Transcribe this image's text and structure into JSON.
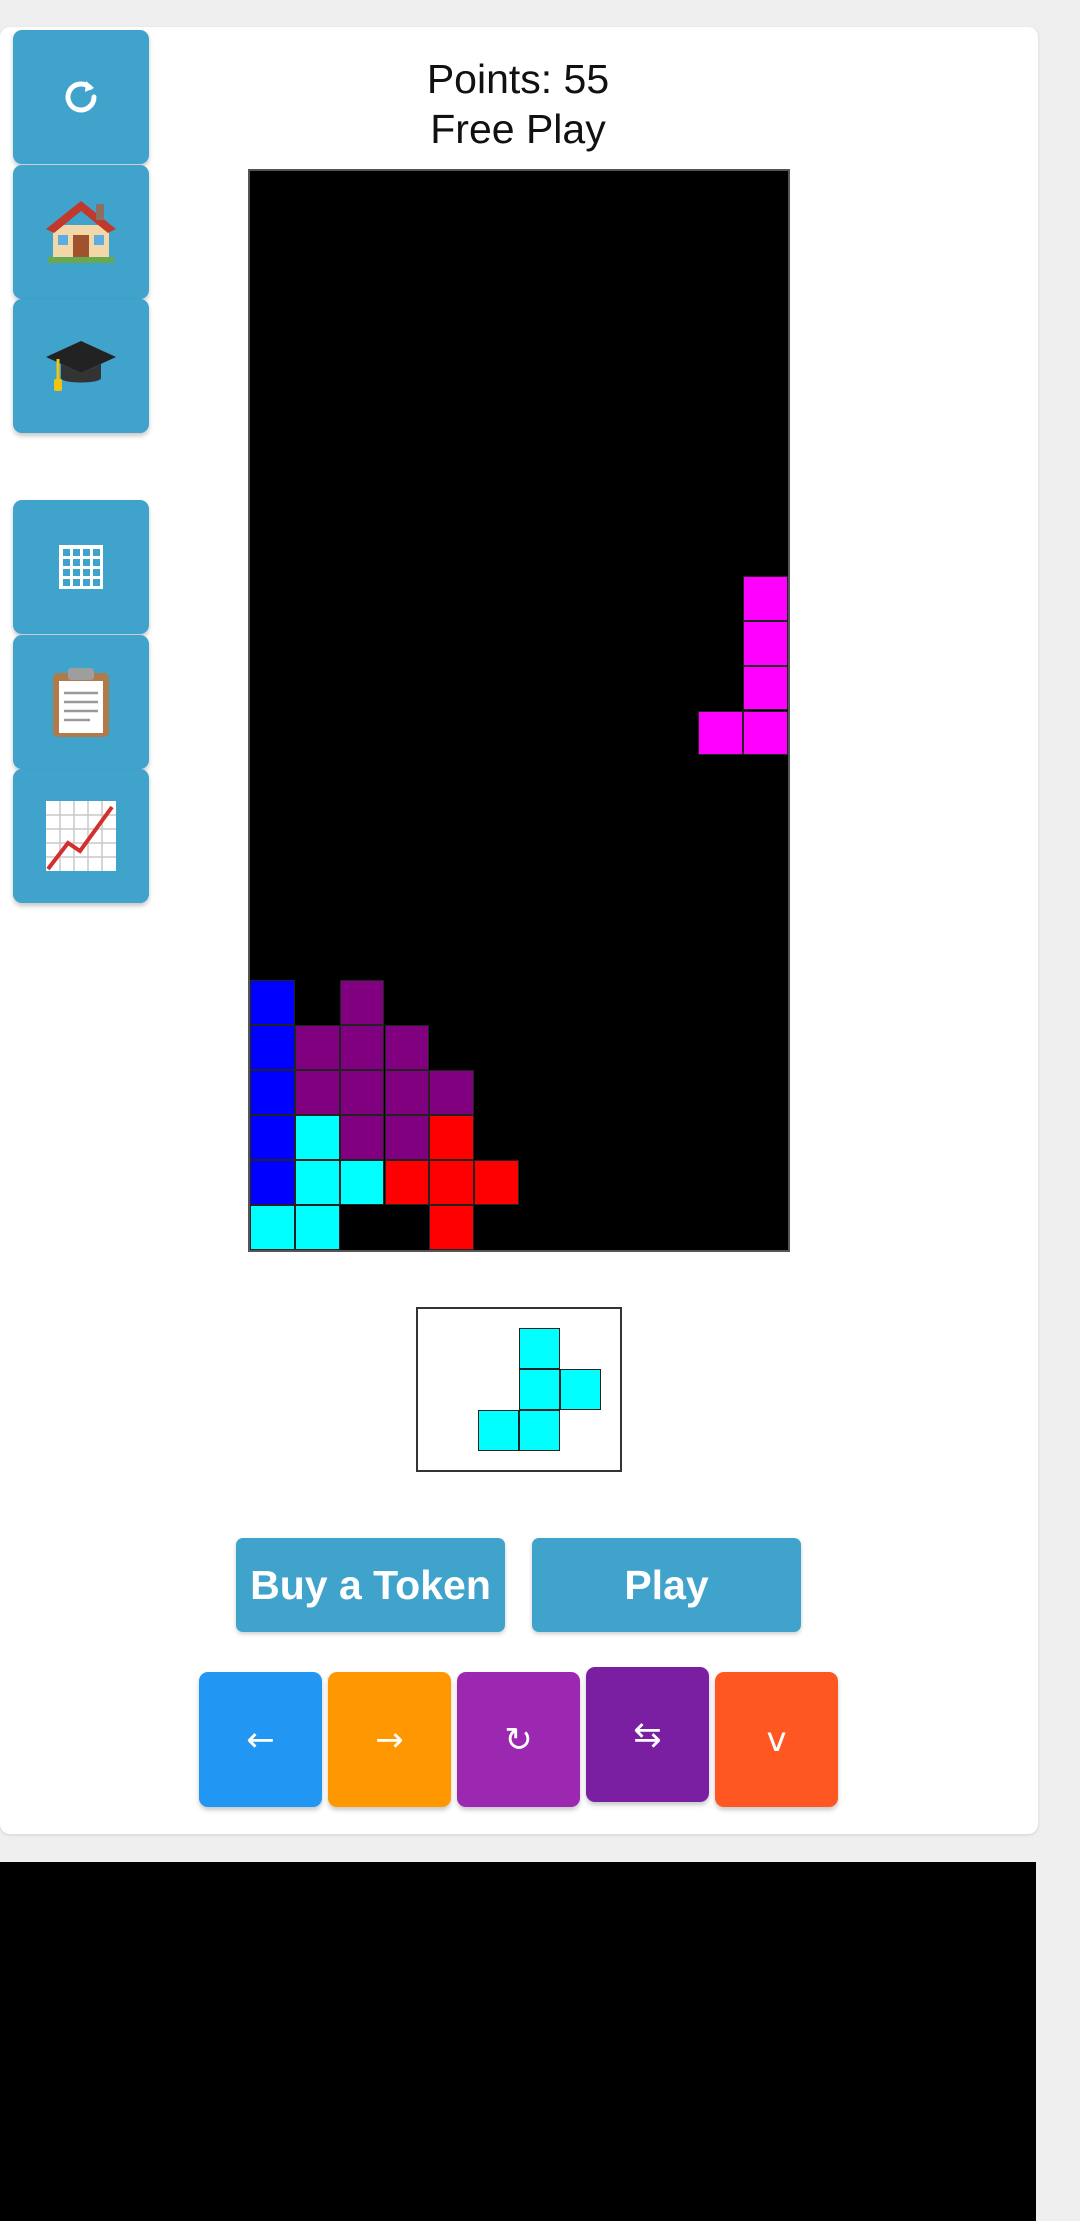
{
  "header": {
    "points_label": "Points: 55",
    "mode_label": "Free Play"
  },
  "sidebar": [
    {
      "icon": "refresh-icon",
      "name": "refresh-button"
    },
    {
      "icon": "house-icon",
      "name": "home-button"
    },
    {
      "icon": "graduation-cap-icon",
      "name": "learn-button"
    },
    {
      "icon": "grid-icon",
      "name": "grid-button"
    },
    {
      "icon": "clipboard-icon",
      "name": "clipboard-button"
    },
    {
      "icon": "chart-increasing-icon",
      "name": "stats-button"
    }
  ],
  "board": {
    "columns": 12,
    "rows": 24,
    "colors": {
      "blue": "#0000ff",
      "purple": "#800080",
      "cyan": "#00ffff",
      "red": "#ff0000",
      "magenta": "#ff00ff"
    },
    "cells": [
      {
        "col": 0,
        "row": 18,
        "color": "blue"
      },
      {
        "col": 0,
        "row": 19,
        "color": "blue"
      },
      {
        "col": 0,
        "row": 20,
        "color": "blue"
      },
      {
        "col": 0,
        "row": 21,
        "color": "blue"
      },
      {
        "col": 0,
        "row": 22,
        "color": "blue"
      },
      {
        "col": 0,
        "row": 23,
        "color": "cyan"
      },
      {
        "col": 1,
        "row": 19,
        "color": "purple"
      },
      {
        "col": 1,
        "row": 20,
        "color": "purple"
      },
      {
        "col": 1,
        "row": 21,
        "color": "cyan"
      },
      {
        "col": 1,
        "row": 22,
        "color": "cyan"
      },
      {
        "col": 1,
        "row": 23,
        "color": "cyan"
      },
      {
        "col": 2,
        "row": 18,
        "color": "purple"
      },
      {
        "col": 2,
        "row": 19,
        "color": "purple"
      },
      {
        "col": 2,
        "row": 20,
        "color": "purple"
      },
      {
        "col": 2,
        "row": 21,
        "color": "purple"
      },
      {
        "col": 2,
        "row": 22,
        "color": "cyan"
      },
      {
        "col": 3,
        "row": 19,
        "color": "purple"
      },
      {
        "col": 3,
        "row": 20,
        "color": "purple"
      },
      {
        "col": 3,
        "row": 21,
        "color": "purple"
      },
      {
        "col": 3,
        "row": 22,
        "color": "red"
      },
      {
        "col": 4,
        "row": 20,
        "color": "purple"
      },
      {
        "col": 4,
        "row": 21,
        "color": "red"
      },
      {
        "col": 4,
        "row": 22,
        "color": "red"
      },
      {
        "col": 4,
        "row": 23,
        "color": "red"
      },
      {
        "col": 5,
        "row": 22,
        "color": "red"
      },
      {
        "col": 11,
        "row": 9,
        "color": "magenta"
      },
      {
        "col": 11,
        "row": 10,
        "color": "magenta"
      },
      {
        "col": 11,
        "row": 11,
        "color": "magenta"
      },
      {
        "col": 11,
        "row": 12,
        "color": "magenta"
      },
      {
        "col": 10,
        "row": 12,
        "color": "magenta"
      }
    ]
  },
  "next_piece": {
    "color": "#00ffff",
    "cells": [
      {
        "col": 2,
        "row": 0
      },
      {
        "col": 2,
        "row": 1
      },
      {
        "col": 3,
        "row": 1
      },
      {
        "col": 1,
        "row": 2
      },
      {
        "col": 2,
        "row": 2
      }
    ]
  },
  "actions": {
    "buy_token_label": "Buy a Token",
    "play_label": "Play"
  },
  "controls": [
    {
      "name": "move-left-button",
      "icon": "arrow-left-icon",
      "glyph": "←",
      "color": "#2196f3"
    },
    {
      "name": "move-right-button",
      "icon": "arrow-right-icon",
      "glyph": "→",
      "color": "#ff9800"
    },
    {
      "name": "rotate-button",
      "icon": "rotate-icon",
      "glyph": "↻",
      "color": "#9c27b0"
    },
    {
      "name": "swap-button",
      "icon": "swap-icon",
      "glyph": "⇆",
      "color": "#7b1fa2"
    },
    {
      "name": "drop-button",
      "icon": "chevron-down-icon",
      "glyph": "v",
      "color": "#ff5722"
    }
  ]
}
